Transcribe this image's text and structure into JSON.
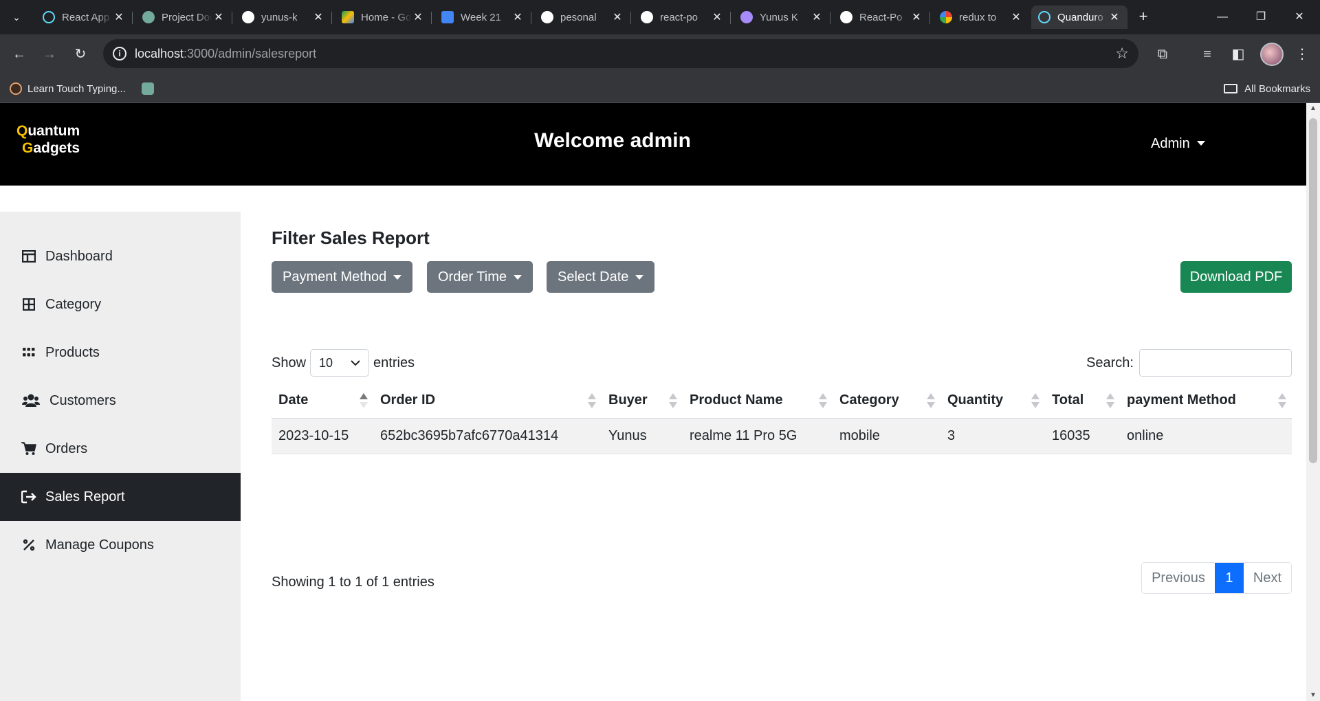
{
  "browser": {
    "tabs": [
      {
        "label": "React App",
        "favicon": "react-icon",
        "color": "#61dafb"
      },
      {
        "label": "Project Documentation",
        "favicon": "chatgpt-icon",
        "color": "#74aa9c"
      },
      {
        "label": "yunus-k",
        "favicon": "github-icon",
        "color": "#ffffff"
      },
      {
        "label": "Home - Google Drive",
        "favicon": "google-drive-icon",
        "color": "#fbbc04"
      },
      {
        "label": "Week 21",
        "favicon": "google-docs-icon",
        "color": "#4285f4"
      },
      {
        "label": "pesonal",
        "favicon": "github-icon",
        "color": "#ffffff"
      },
      {
        "label": "react-po",
        "favicon": "github-icon",
        "color": "#ffffff"
      },
      {
        "label": "Yunus K",
        "favicon": "profile-icon",
        "color": "#a78bfa"
      },
      {
        "label": "React-Po",
        "favicon": "github-icon",
        "color": "#ffffff"
      },
      {
        "label": "redux to",
        "favicon": "google-icon",
        "color": "#ea4335"
      },
      {
        "label": "Quanduro",
        "favicon": "react-icon",
        "color": "#61dafb"
      }
    ],
    "url_host": "localhost",
    "url_path": ":3000/admin/salesreport",
    "bookmarks": [
      {
        "label": "Learn Touch Typing..."
      }
    ],
    "all_bookmarks_label": "All Bookmarks"
  },
  "header": {
    "brand_first_letter_1": "Q",
    "brand_rest_1": "uantum",
    "brand_first_letter_2": "G",
    "brand_rest_2": "adgets",
    "welcome": "Welcome admin",
    "user_menu": "Admin",
    "accent_color": "#f7c200"
  },
  "sidebar": {
    "items": [
      {
        "label": "Dashboard",
        "icon": "dashboard-icon",
        "active": false
      },
      {
        "label": "Category",
        "icon": "grid-icon",
        "active": false
      },
      {
        "label": "Products",
        "icon": "apps-icon",
        "active": false
      },
      {
        "label": "Customers",
        "icon": "users-icon",
        "active": false
      },
      {
        "label": "Orders",
        "icon": "cart-icon",
        "active": false
      },
      {
        "label": "Sales Report",
        "icon": "sign-out-icon",
        "active": true
      },
      {
        "label": "Manage Coupons",
        "icon": "percent-icon",
        "active": false
      }
    ]
  },
  "main": {
    "title": "Filter Sales Report",
    "filters": {
      "payment_method": "Payment Method",
      "order_time": "Order Time",
      "select_date": "Select Date"
    },
    "download_pdf": "Download PDF",
    "show_label": "Show",
    "page_length": "10",
    "entries_label": "entries",
    "search_label": "Search:",
    "search_value": "",
    "table": {
      "columns": [
        "Date",
        "Order ID",
        "Buyer",
        "Product Name",
        "Category",
        "Quantity",
        "Total",
        "payment Method"
      ],
      "rows": [
        [
          "2023-10-15",
          "652bc3695b7afc6770a41314",
          "Yunus",
          "realme 11 Pro 5G",
          "mobile",
          "3",
          "16035",
          "online"
        ]
      ]
    },
    "info": "Showing 1 to 1 of 1 entries",
    "pagination": {
      "previous": "Previous",
      "current": "1",
      "next": "Next"
    },
    "colors": {
      "filter_button": "#6c757d",
      "pdf_button": "#198754",
      "page_active": "#0d6efd"
    }
  }
}
